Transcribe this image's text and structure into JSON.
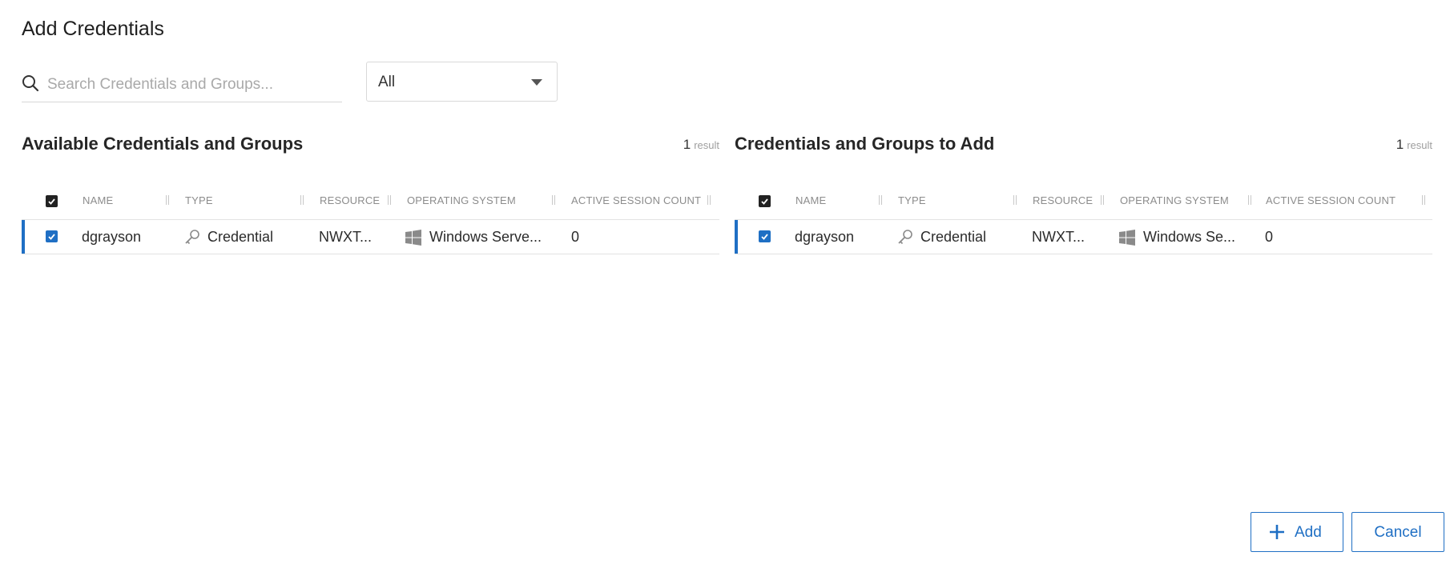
{
  "page": {
    "title": "Add Credentials"
  },
  "search": {
    "placeholder": "Search Credentials and Groups..."
  },
  "filter": {
    "selected": "All"
  },
  "colors": {
    "accent": "#1f6fc4",
    "header_checkbox": "#222222"
  },
  "available": {
    "title": "Available Credentials and Groups",
    "count": "1",
    "count_label": "result",
    "columns": [
      "NAME",
      "TYPE",
      "RESOURCE",
      "OPERATING SYSTEM",
      "ACTIVE SESSION COUNT"
    ],
    "rows": [
      {
        "name": "dgrayson",
        "type_icon": "key-icon",
        "type": "Credential",
        "resource": "NWXT...",
        "os_icon": "windows-icon",
        "os": "Windows Serve...",
        "active_sessions": "0"
      }
    ]
  },
  "to_add": {
    "title": "Credentials and Groups to Add",
    "count": "1",
    "count_label": "result",
    "columns": [
      "NAME",
      "TYPE",
      "RESOURCE",
      "OPERATING SYSTEM",
      "ACTIVE SESSION COUNT"
    ],
    "rows": [
      {
        "name": "dgrayson",
        "type_icon": "key-icon",
        "type": "Credential",
        "resource": "NWXT...",
        "os_icon": "windows-icon",
        "os": "Windows Se...",
        "active_sessions": "0"
      }
    ]
  },
  "actions": {
    "add_label": "Add",
    "add_icon": "plus-icon",
    "cancel_label": "Cancel"
  }
}
